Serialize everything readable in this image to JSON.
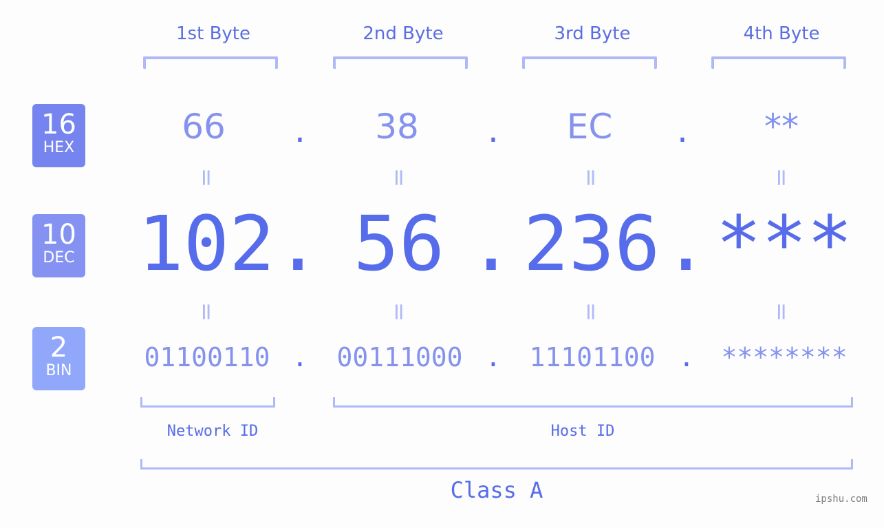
{
  "headers": [
    "1st Byte",
    "2nd Byte",
    "3rd Byte",
    "4th Byte"
  ],
  "badges": [
    {
      "num": "16",
      "label": "HEX",
      "color": "#7584ee"
    },
    {
      "num": "10",
      "label": "DEC",
      "color": "#8592f2"
    },
    {
      "num": "2",
      "label": "BIN",
      "color": "#91a8fa"
    }
  ],
  "hex": [
    "66",
    "38",
    "EC",
    "**"
  ],
  "dec": [
    "102",
    "56",
    "236",
    "***"
  ],
  "bin": [
    "01100110",
    "00111000",
    "11101100",
    "********"
  ],
  "separator": ".",
  "equals": "=",
  "network_label": "Network ID",
  "host_label": "Host ID",
  "class_label": "Class A",
  "watermark": "ipshu.com"
}
